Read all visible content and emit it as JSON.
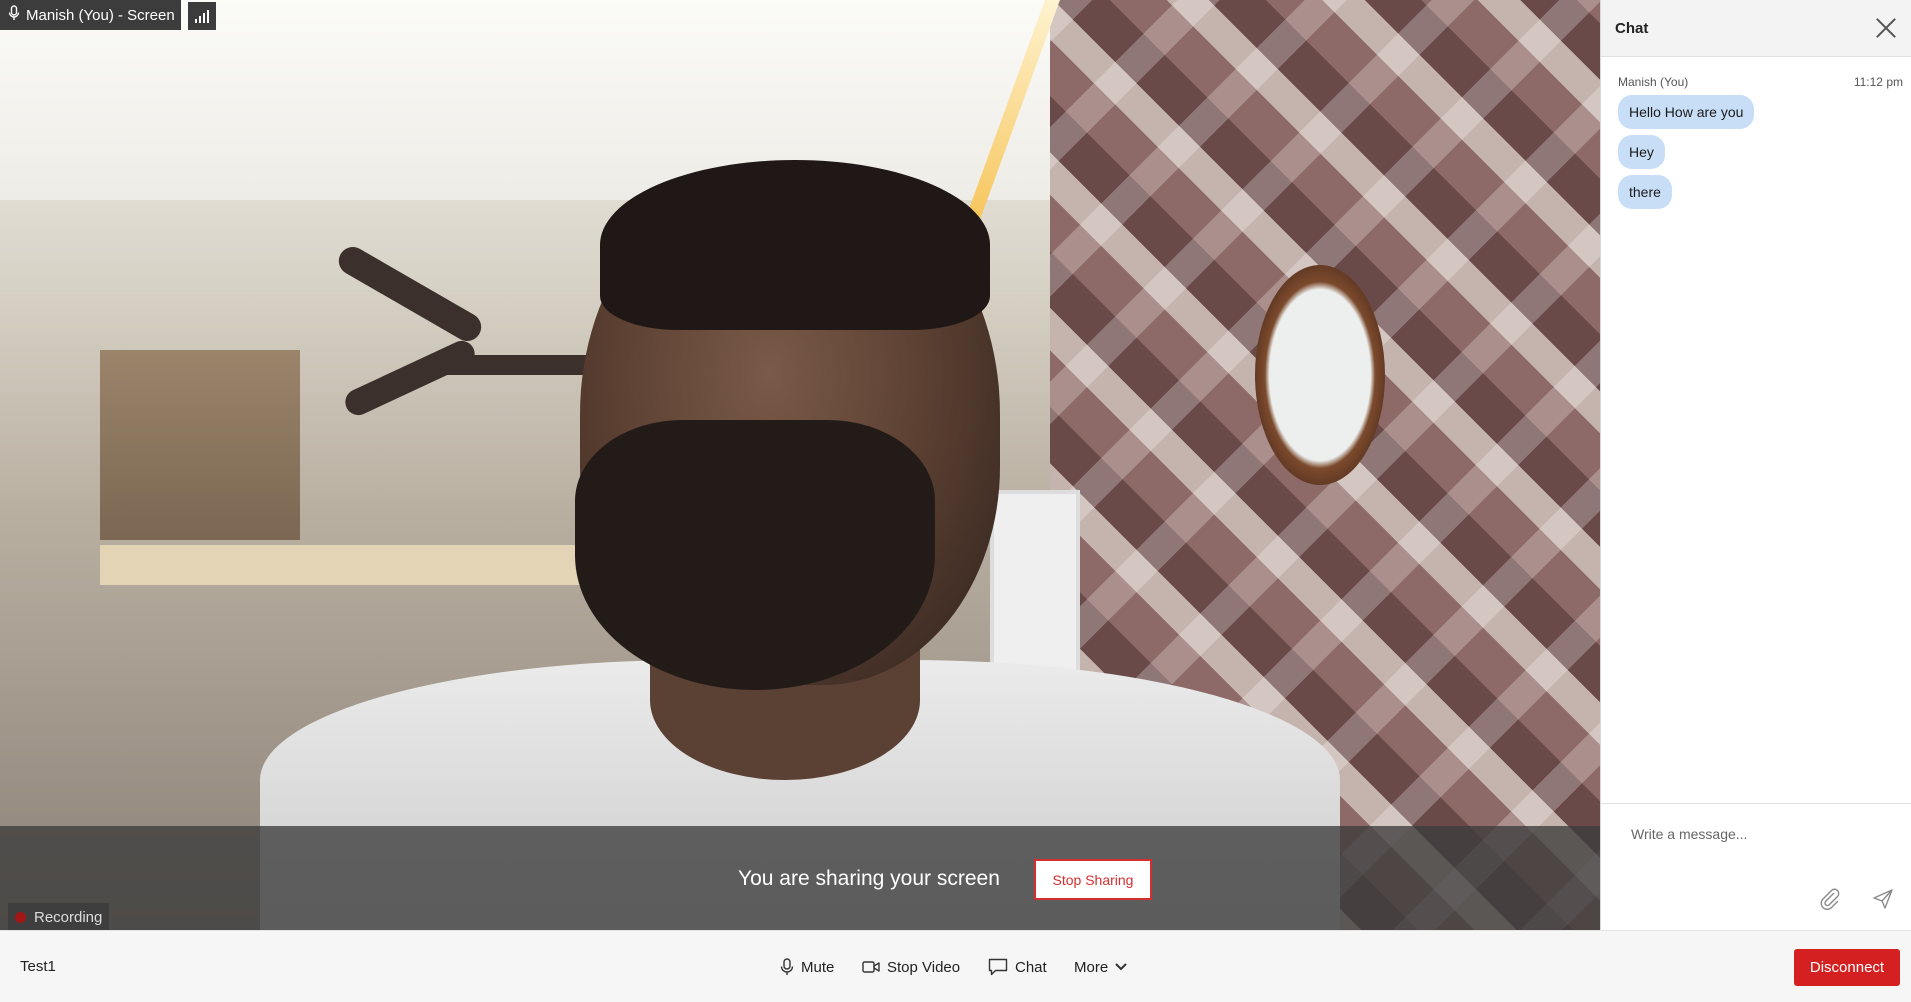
{
  "participant_tag": {
    "label": "Manish (You) - Screen"
  },
  "share_banner": {
    "message": "You are sharing your screen",
    "stop_label": "Stop Sharing"
  },
  "recording": {
    "label": "Recording"
  },
  "chat": {
    "title": "Chat",
    "sender": "Manish (You)",
    "time": "11:12 pm",
    "messages": [
      "Hello How are you",
      "Hey",
      "there"
    ],
    "input_placeholder": "Write a message..."
  },
  "toolbar": {
    "meeting_name": "Test1",
    "mute_label": "Mute",
    "stop_video_label": "Stop Video",
    "chat_label": "Chat",
    "more_label": "More",
    "disconnect_label": "Disconnect"
  },
  "colors": {
    "disconnect": "#d42020",
    "bubble": "#c7def6",
    "stop_sharing": "#d32f2f"
  }
}
